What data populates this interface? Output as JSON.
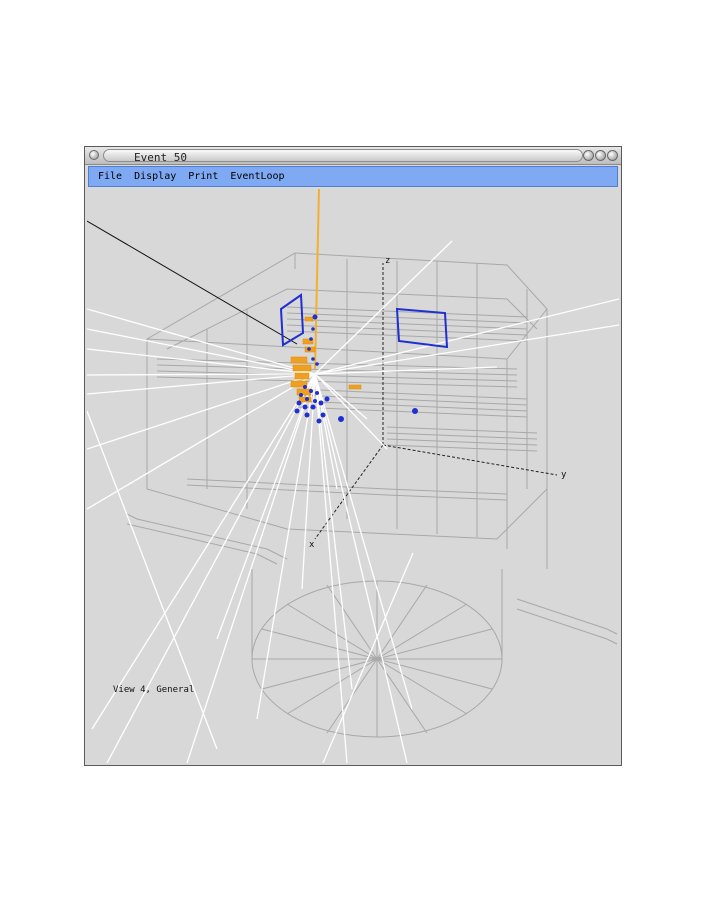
{
  "window": {
    "title": "Event 50"
  },
  "menubar": {
    "items": [
      {
        "label": "File"
      },
      {
        "label": "Display"
      },
      {
        "label": "Print"
      },
      {
        "label": "EventLoop"
      }
    ]
  },
  "viewer": {
    "view_label": "View 4, General",
    "axes": {
      "z": "z",
      "y": "y",
      "x": "x"
    }
  },
  "colors": {
    "menubar": "#7fa9f2",
    "canvas_background": "#d8d8d8",
    "tracks": "#ffffff",
    "detector_wireframe": "#a8a8a8",
    "hits_blue": "#1f2fd0",
    "calorimeter_orange": "#f0a020"
  }
}
